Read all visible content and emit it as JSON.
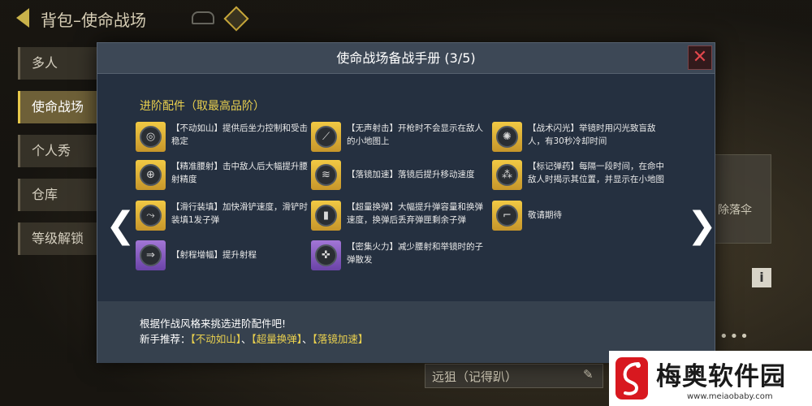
{
  "background": {
    "back_title": "背包–使命战场",
    "side_menu": [
      "多人",
      "使命战场",
      "个人秀",
      "仓库",
      "等级解锁"
    ],
    "active_index": 1,
    "right_label": "除落伞",
    "info_icon": "i",
    "dots": "•••",
    "bottom_field": "远狙（记得趴）",
    "edit_icon": "✎"
  },
  "modal": {
    "title": "使命战场备战手册 (3/5)",
    "close_icon": "✕",
    "section_title": "进阶配件（取最高品阶）",
    "nav_left": "❮",
    "nav_right": "❯",
    "perks": [
      {
        "icon": "steadfast-icon",
        "tier": "gold",
        "glyph": "◎",
        "text": "【不动如山】提供后坐力控制和受击稳定"
      },
      {
        "icon": "silencer-icon",
        "tier": "gold",
        "glyph": "⟋",
        "text": "【无声射击】开枪时不会显示在敌人的小地图上"
      },
      {
        "icon": "tactical-flash-icon",
        "tier": "gold",
        "glyph": "✺",
        "text": "【战术闪光】举镜时用闪光致盲敌人，有30秒冷却时间"
      },
      {
        "icon": "crosshair-icon",
        "tier": "gold",
        "glyph": "⊕",
        "text": "【精准腰射】击中敌人后大幅提升腰射精度"
      },
      {
        "icon": "ads-speed-icon",
        "tier": "gold",
        "glyph": "≋",
        "text": "【落镜加速】落镜后提升移动速度"
      },
      {
        "icon": "marker-round-icon",
        "tier": "gold",
        "glyph": "⁂",
        "text": "【标记弹药】每隔一段时间，在命中敌人时揭示其位置，并显示在小地图"
      },
      {
        "icon": "slide-reload-icon",
        "tier": "gold",
        "glyph": "⤳",
        "text": "【滑行装填】加快滑铲速度，滑铲时装填1发子弹"
      },
      {
        "icon": "overload-magazine-icon",
        "tier": "gold",
        "glyph": "▮",
        "text": "【超量换弹】大幅提升弹容量和换弹速度，换弹后丢弃弹匣剩余子弹"
      },
      {
        "icon": "coming-soon-icon",
        "tier": "gold",
        "glyph": "⌐",
        "text": "敬请期待"
      },
      {
        "icon": "range-boost-icon",
        "tier": "purple",
        "glyph": "⇒",
        "text": "【射程增幅】提升射程"
      },
      {
        "icon": "focused-fire-icon",
        "tier": "purple",
        "glyph": "✜",
        "text": "【密集火力】减少腰射和举镜时的子弹散发"
      }
    ],
    "tip_line1": "根据作战风格来挑选进阶配件吧!",
    "tip_prefix": "新手推荐：",
    "tip_items": [
      "【不动如山】",
      "【超量换弹】",
      "【落镜加速】"
    ],
    "tip_separator": "、"
  },
  "watermark": {
    "title": "梅奥软件园",
    "url": "www.meiaobaby.com"
  }
}
